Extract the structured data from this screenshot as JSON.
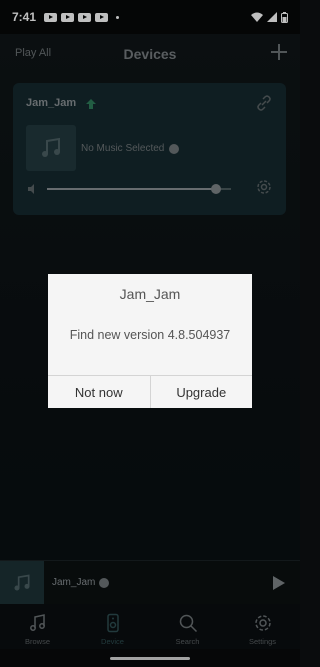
{
  "status_bar": {
    "time": "7:41"
  },
  "header": {
    "play_all": "Play All",
    "title": "Devices"
  },
  "device_card": {
    "name": "Jam_Jam",
    "track": "No Music Selected",
    "volume_level": 0.92
  },
  "dialog": {
    "title": "Jam_Jam",
    "message": "Find new version  4.8.504937",
    "cancel_label": "Not now",
    "confirm_label": "Upgrade"
  },
  "mini_player": {
    "title": "Jam_Jam"
  },
  "nav": {
    "browse": "Browse",
    "device": "Device",
    "search": "Search",
    "settings": "Settings",
    "active": "device"
  },
  "colors": {
    "dialog_bg": "#f5f5f5",
    "accent": "#2e7d5a",
    "card_bg": "#15292e"
  }
}
